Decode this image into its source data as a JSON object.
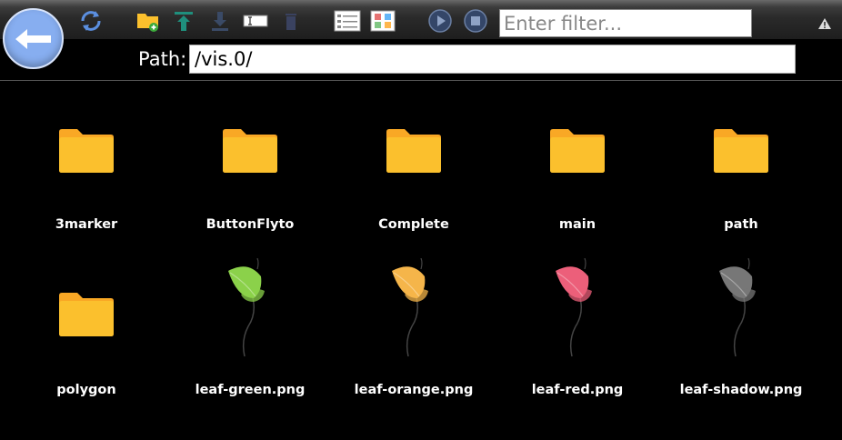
{
  "toolbar": {
    "filter_placeholder": "Enter filter...",
    "icons": [
      "back-arrow-icon",
      "refresh-icon",
      "new-folder-icon",
      "upload-icon",
      "download-icon",
      "rename-icon",
      "delete-icon",
      "list-view-icon",
      "grid-view-icon",
      "play-icon",
      "stop-icon",
      "warning-icon"
    ]
  },
  "path": {
    "label": "Path:",
    "value": "/vis.0/"
  },
  "colors": {
    "accent": "#87aef0",
    "folder": "#fbc02d",
    "folder_dark": "#f9a825"
  },
  "items": [
    {
      "name": "3marker",
      "type": "folder"
    },
    {
      "name": "ButtonFlyto",
      "type": "folder"
    },
    {
      "name": "Complete",
      "type": "folder"
    },
    {
      "name": "main",
      "type": "folder"
    },
    {
      "name": "path",
      "type": "folder"
    },
    {
      "name": "polygon",
      "type": "folder"
    },
    {
      "name": "leaf-green.png",
      "type": "image",
      "color": "#8bd14a"
    },
    {
      "name": "leaf-orange.png",
      "type": "image",
      "color": "#f5b54a"
    },
    {
      "name": "leaf-red.png",
      "type": "image",
      "color": "#ec5f7a"
    },
    {
      "name": "leaf-shadow.png",
      "type": "image",
      "color": "#777777"
    }
  ]
}
